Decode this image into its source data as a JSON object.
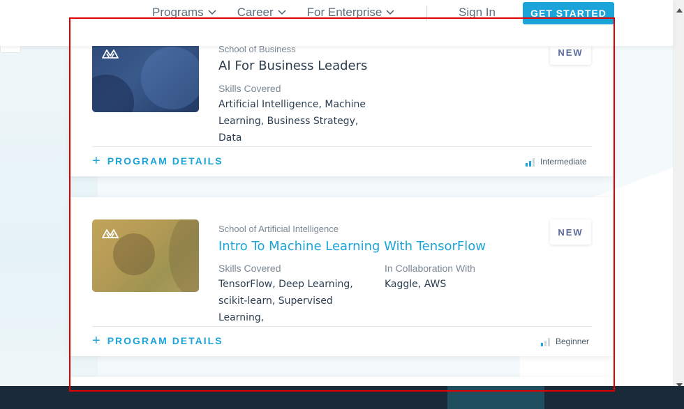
{
  "header": {
    "nav": [
      {
        "label": "Programs"
      },
      {
        "label": "Career"
      },
      {
        "label": "For Enterprise"
      }
    ],
    "sign_in": "Sign In",
    "cta": "GET STARTED"
  },
  "cards": [
    {
      "school": "School of Business",
      "title": "AI For Business Leaders",
      "badge": "NEW",
      "skills_heading": "Skills Covered",
      "skills": "Artificial Intelligence, Machine Learning, Business Strategy, Data",
      "details_label": "PROGRAM DETAILS",
      "level": "Intermediate",
      "level_value": 2,
      "level_max": 3
    },
    {
      "school": "School of Artificial Intelligence",
      "title": "Intro To Machine Learning With TensorFlow",
      "badge": "NEW",
      "skills_heading": "Skills Covered",
      "skills": "TensorFlow, Deep Learning, scikit-learn, Supervised Learning,",
      "collab_heading": "In Collaboration With",
      "collab": "Kaggle, AWS",
      "details_label": "PROGRAM DETAILS",
      "level": "Beginner",
      "level_value": 1,
      "level_max": 3
    }
  ],
  "colors": {
    "accent": "#1ba4d9",
    "badge_text": "#5a6b9a",
    "title_dark": "#2c3e50",
    "selection": "#e00000"
  }
}
